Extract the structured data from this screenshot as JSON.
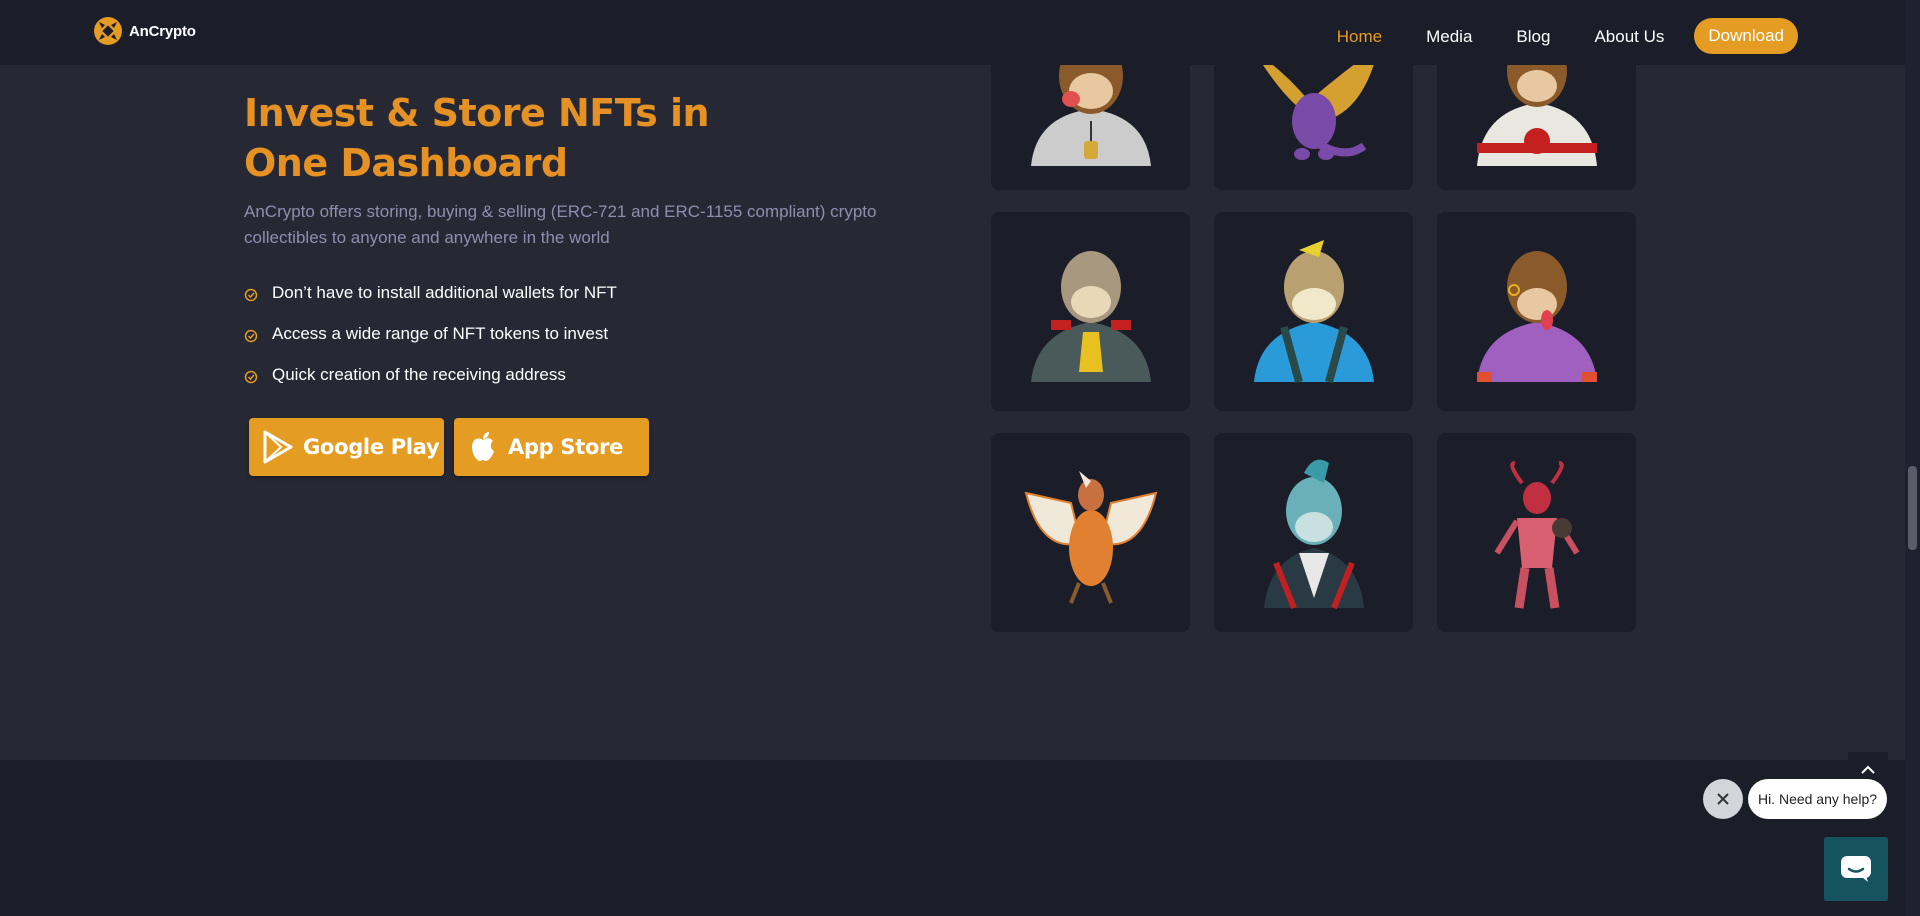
{
  "header": {
    "logo_text": "AnCrypto",
    "nav": [
      "Home",
      "Media",
      "Blog",
      "About Us"
    ],
    "active_nav": "Home",
    "download_label": "Download"
  },
  "hero": {
    "title": "Invest & Store NFTs in One Dashboard",
    "description": "AnCrypto offers storing, buying & selling (ERC-721 and ERC-1155 compliant) crypto collectibles to anyone and anywhere in the world",
    "features": [
      "Don’t have to install additional wallets for NFT",
      "Access a wide range of NFT tokens to invest",
      "Quick creation of the receiving address"
    ],
    "google_play_label": "Google Play",
    "app_store_label": "App Store"
  },
  "nft_grid": {
    "items": [
      {
        "name": "ape-gold-chain",
        "icon": "ape-icon"
      },
      {
        "name": "purple-dragon",
        "icon": "dragon-icon"
      },
      {
        "name": "ape-hoodie-red-dot",
        "icon": "ape-icon"
      },
      {
        "name": "ape-military-coat",
        "icon": "ape-icon"
      },
      {
        "name": "ape-blue-overalls",
        "icon": "ape-icon"
      },
      {
        "name": "ape-purple-shirt",
        "icon": "ape-icon"
      },
      {
        "name": "orange-bird",
        "icon": "bird-icon"
      },
      {
        "name": "ape-punk-jacket",
        "icon": "ape-icon"
      },
      {
        "name": "red-demon",
        "icon": "demon-icon"
      }
    ]
  },
  "chat": {
    "bubble_text": "Hi. Need any help?"
  },
  "colors": {
    "accent": "#e49c23",
    "title": "#e59123",
    "bg": "#262834",
    "header_bg": "#1b1d29",
    "muted_text": "#8e8fae",
    "chat_launcher": "#15545e"
  }
}
